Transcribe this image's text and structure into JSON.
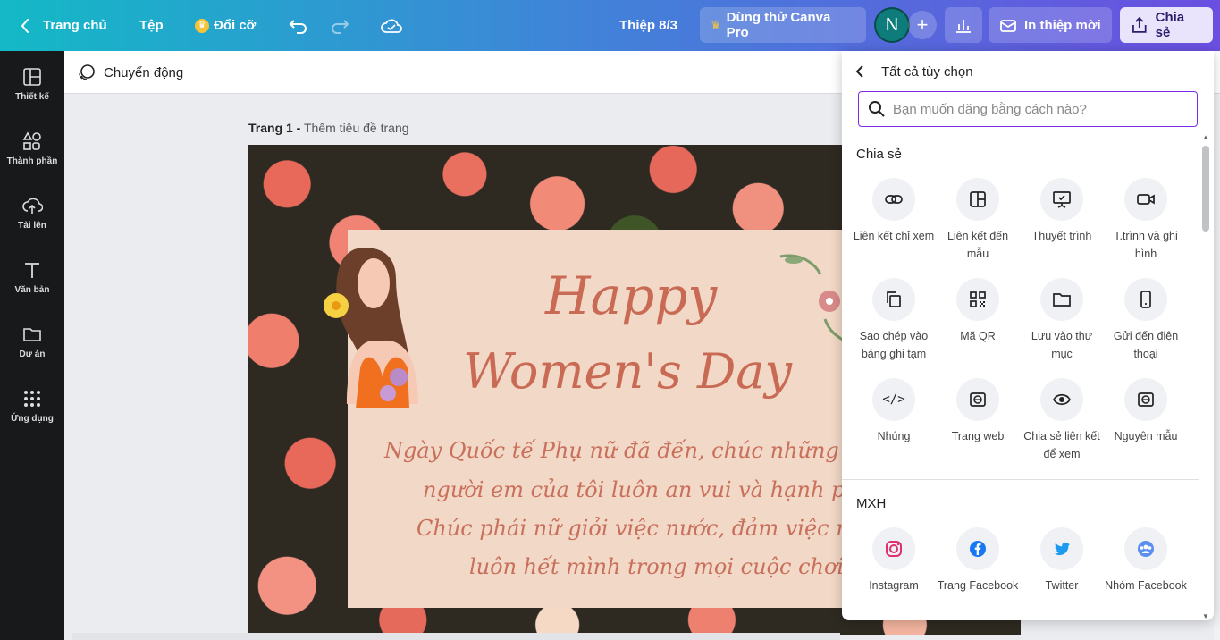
{
  "topbar": {
    "back_label": "Trang chủ",
    "file_label": "Tệp",
    "resize_label": "Đổi cỡ",
    "doc_title": "Thiệp 8/3",
    "try_pro_label": "Dùng thử Canva Pro",
    "avatar_initial": "N",
    "print_invite_label": "In thiệp mời",
    "share_label": "Chia sẻ"
  },
  "sidebar": {
    "items": [
      {
        "label": "Thiết kế",
        "icon": "layout-icon"
      },
      {
        "label": "Thành phần",
        "icon": "shapes-icon"
      },
      {
        "label": "Tải lên",
        "icon": "cloud-upload-icon"
      },
      {
        "label": "Văn bản",
        "icon": "text-icon"
      },
      {
        "label": "Dự án",
        "icon": "folder-icon"
      },
      {
        "label": "Ứng dụng",
        "icon": "apps-grid-icon"
      }
    ]
  },
  "toolbar": {
    "animate_label": "Chuyển động"
  },
  "canvas": {
    "page_label": "Trang 1 -",
    "page_title_placeholder": "Thêm tiêu đề trang",
    "card": {
      "line1": "Happy",
      "line2": "Women's Day",
      "message": [
        "Ngày Quốc tế Phụ nữ đã đến, chúc những người",
        "người em của tôi luôn an vui và hạnh phúc",
        "Chúc phái nữ giỏi việc nước, đảm việc nhà v",
        "luôn hết mình trong mọi cuộc chơi."
      ]
    }
  },
  "share_panel": {
    "header": "Tất cả tùy chọn",
    "search_placeholder": "Bạn muốn đăng bằng cách nào?",
    "share_section_title": "Chia sẻ",
    "share_options": [
      {
        "label": "Liên kết chỉ xem",
        "icon": "link-icon"
      },
      {
        "label": "Liên kết đến mẫu",
        "icon": "template-icon"
      },
      {
        "label": "Thuyết trình",
        "icon": "present-icon"
      },
      {
        "label": "T.trình và ghi hình",
        "icon": "video-camera-icon"
      },
      {
        "label": "Sao chép vào bảng ghi tạm",
        "icon": "copy-icon"
      },
      {
        "label": "Mã QR",
        "icon": "qr-code-icon"
      },
      {
        "label": "Lưu vào thư mục",
        "icon": "folder-icon"
      },
      {
        "label": "Gửi đến điện thoại",
        "icon": "phone-icon"
      },
      {
        "label": "Nhúng",
        "icon": "embed-code-icon"
      },
      {
        "label": "Trang web",
        "icon": "website-icon"
      },
      {
        "label": "Chia sẻ liên kết để xem",
        "icon": "eye-icon"
      },
      {
        "label": "Nguyên mẫu",
        "icon": "prototype-icon"
      }
    ],
    "social_section_title": "MXH",
    "social_options": [
      {
        "label": "Instagram",
        "icon": "instagram-icon",
        "color": "#e1306c"
      },
      {
        "label": "Trang Facebook",
        "icon": "facebook-icon",
        "color": "#1877f2"
      },
      {
        "label": "Twitter",
        "icon": "twitter-icon",
        "color": "#1d9bf0"
      },
      {
        "label": "Nhóm Facebook",
        "icon": "facebook-group-icon",
        "color": "#1877f2"
      }
    ]
  }
}
